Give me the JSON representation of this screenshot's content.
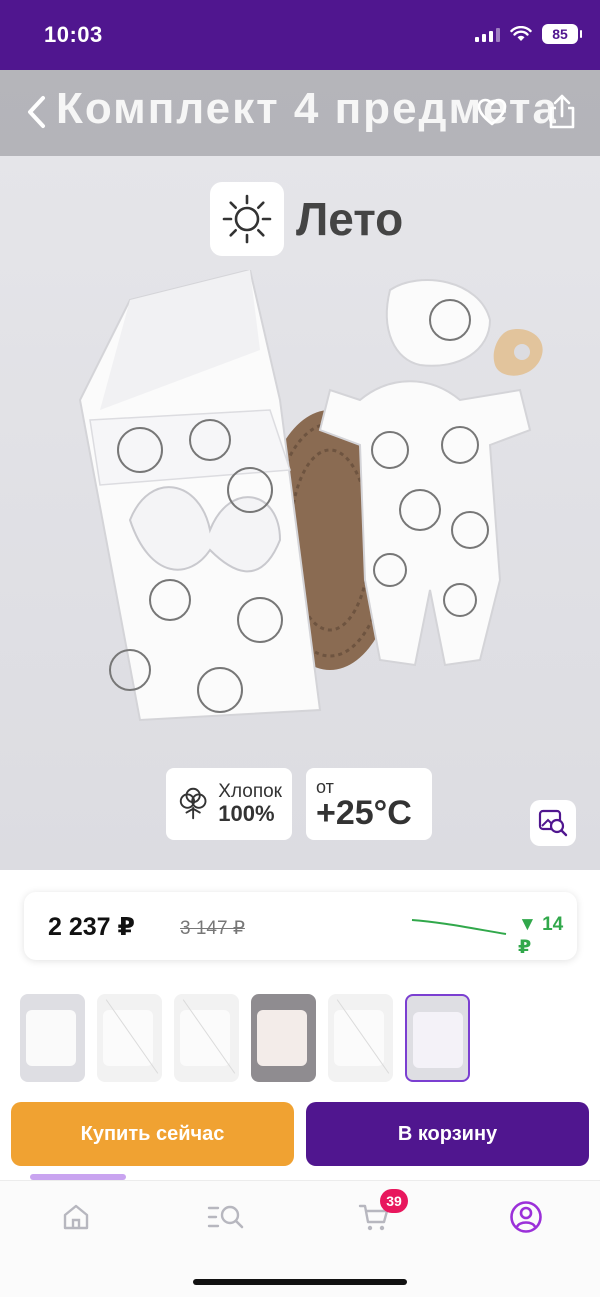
{
  "status_bar": {
    "time": "10:03",
    "battery": "85"
  },
  "product": {
    "title": "Комплект 4 предмета",
    "season_label": "Лето",
    "badges": {
      "cotton_line1": "Хлопок",
      "cotton_line2": "100%",
      "temp_prefix": "от",
      "temp_value": "+25°C"
    }
  },
  "price": {
    "current": "2 237 ₽",
    "old": "3 147 ₽",
    "drop": "▼ 14 ₽",
    "history_color": "#31a84b"
  },
  "actions": {
    "buy_now": "Купить сейчас",
    "add_to_cart": "В корзину"
  },
  "tab_bar": {
    "cart_count": "39",
    "active_color": "#9b30d9"
  },
  "colors": {
    "brand": "#50168f",
    "buy_now": "#f0a232",
    "badge": "#e8175d"
  }
}
